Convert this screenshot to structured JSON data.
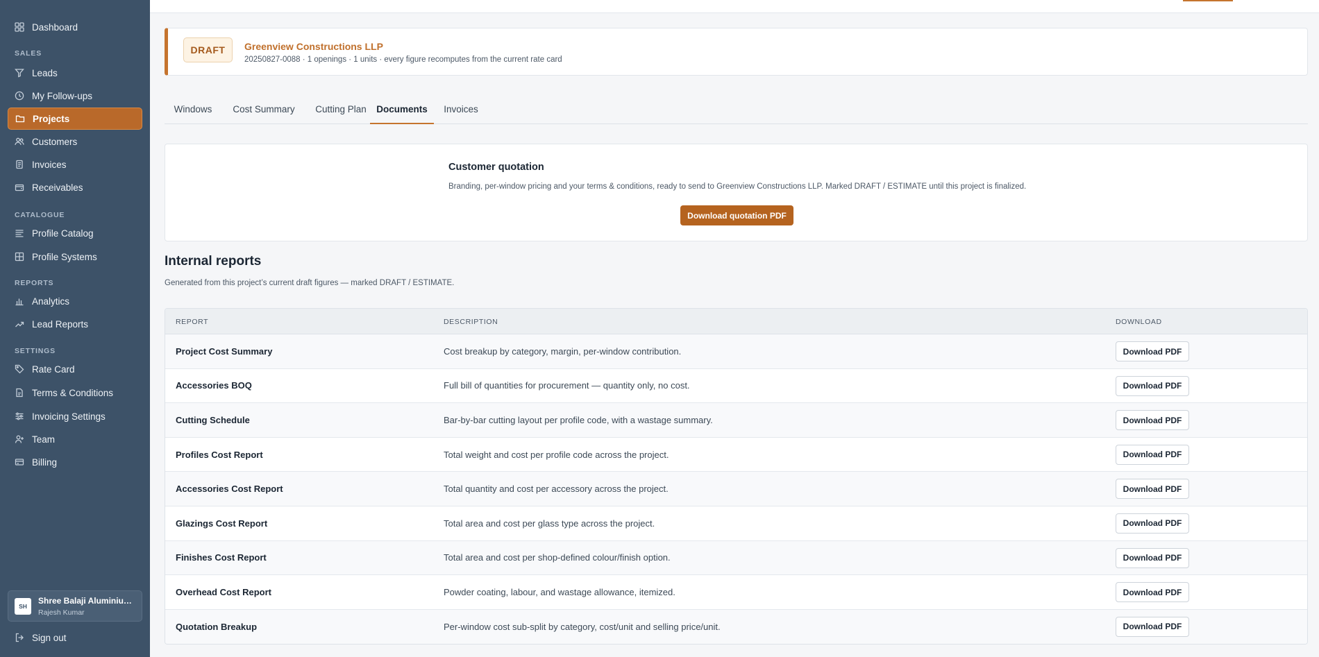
{
  "sidebar": {
    "items": {
      "dashboard": {
        "label": "Dashboard",
        "icon": "grid-icon"
      },
      "leads": {
        "label": "Leads",
        "icon": "filter-icon"
      },
      "followups": {
        "label": "My Follow-ups",
        "icon": "clock-icon"
      },
      "projects": {
        "label": "Projects",
        "icon": "folder-icon"
      },
      "customers": {
        "label": "Customers",
        "icon": "users-icon"
      },
      "invoices": {
        "label": "Invoices",
        "icon": "receipt-icon"
      },
      "receivables": {
        "label": "Receivables",
        "icon": "wallet-icon"
      },
      "profile_catalog": {
        "label": "Profile Catalog",
        "icon": "layers-icon"
      },
      "profile_systems": {
        "label": "Profile Systems",
        "icon": "window-icon"
      },
      "analytics": {
        "label": "Analytics",
        "icon": "bar-chart-icon"
      },
      "lead_reports": {
        "label": "Lead Reports",
        "icon": "trend-icon"
      },
      "rate_card": {
        "label": "Rate Card",
        "icon": "tag-icon"
      },
      "terms": {
        "label": "Terms & Conditions",
        "icon": "document-icon"
      },
      "invoicing_settings": {
        "label": "Invoicing Settings",
        "icon": "sliders-icon"
      },
      "team": {
        "label": "Team",
        "icon": "user-plus-icon"
      },
      "billing": {
        "label": "Billing",
        "icon": "card-icon"
      },
      "sign_out": {
        "label": "Sign out",
        "icon": "logout-icon"
      }
    },
    "sections": {
      "sales": "SALES",
      "catalogue": "CATALOGUE",
      "reports": "REPORTS",
      "settings": "SETTINGS"
    },
    "org": {
      "initials": "SH",
      "name": "Shree Balaji Aluminiu…",
      "user": "Rajesh Kumar"
    }
  },
  "project": {
    "status": "DRAFT",
    "client": "Greenview Constructions LLP",
    "meta": "20250827-0088 · 1 openings · 1 units · every figure recomputes from the current rate card"
  },
  "tabs": [
    "Windows",
    "Cost Summary",
    "Cutting Plan",
    "Documents",
    "Invoices"
  ],
  "active_tab": "Documents",
  "quotation": {
    "title": "Customer quotation",
    "description": "Branding, per-window pricing and your terms & conditions, ready to send to Greenview Constructions LLP. Marked DRAFT / ESTIMATE until this project is finalized.",
    "button": "Download quotation PDF"
  },
  "internal_reports": {
    "heading": "Internal reports",
    "subtitle": "Generated from this project’s current draft figures — marked DRAFT / ESTIMATE.",
    "columns": {
      "report": "REPORT",
      "description": "DESCRIPTION",
      "download": "DOWNLOAD"
    },
    "download_label": "Download PDF",
    "rows": [
      {
        "report": "Project Cost Summary",
        "description": "Cost breakup by category, margin, per-window contribution."
      },
      {
        "report": "Accessories BOQ",
        "description": "Full bill of quantities for procurement — quantity only, no cost."
      },
      {
        "report": "Cutting Schedule",
        "description": "Bar-by-bar cutting layout per profile code, with a wastage summary."
      },
      {
        "report": "Profiles Cost Report",
        "description": "Total weight and cost per profile code across the project."
      },
      {
        "report": "Accessories Cost Report",
        "description": "Total quantity and cost per accessory across the project."
      },
      {
        "report": "Glazings Cost Report",
        "description": "Total area and cost per glass type across the project."
      },
      {
        "report": "Finishes Cost Report",
        "description": "Total area and cost per shop-defined colour/finish option."
      },
      {
        "report": "Overhead Cost Report",
        "description": "Powder coating, labour, and wastage allowance, itemized."
      },
      {
        "report": "Quotation Breakup",
        "description": "Per-window cost sub-split by category, cost/unit and selling price/unit."
      }
    ]
  },
  "colors": {
    "sidebar_bg": "#3d5268",
    "accent": "#c5742e",
    "active_nav": "#b9692a",
    "primary_button": "#b5631f"
  }
}
